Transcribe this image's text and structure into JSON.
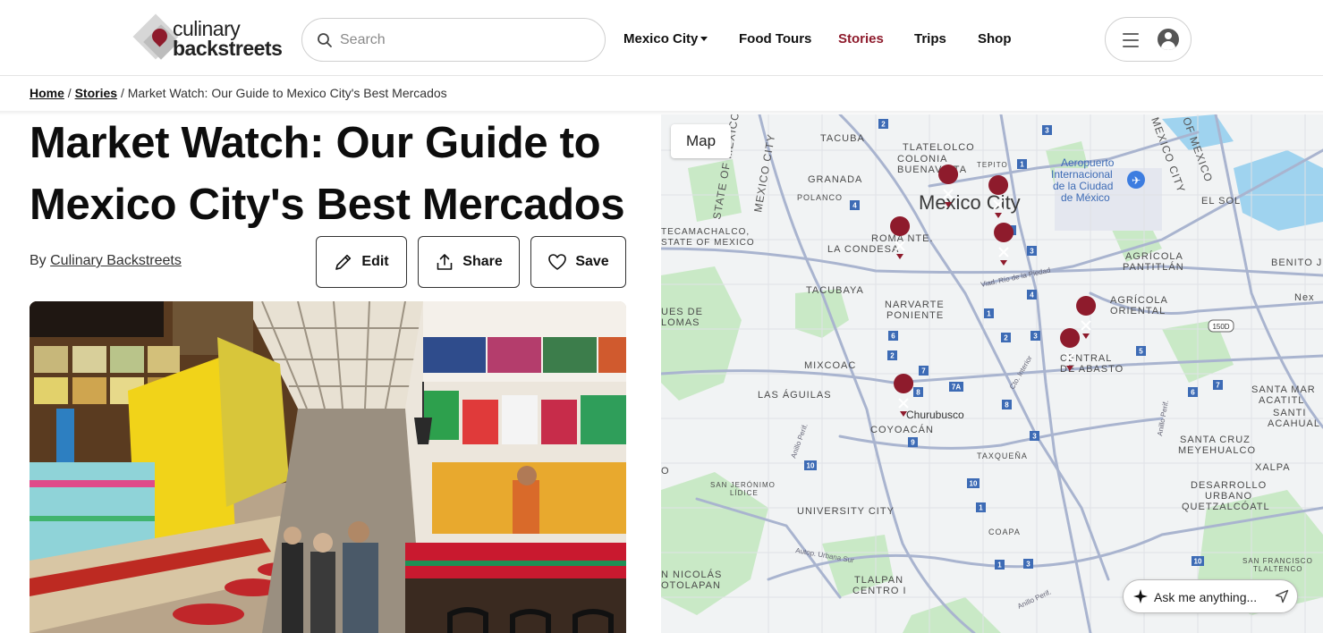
{
  "header": {
    "logo_line1": "culinary",
    "logo_line2": "backstreets",
    "search_placeholder": "Search",
    "nav": [
      {
        "label": "Mexico City",
        "has_dropdown": true
      },
      {
        "label": "Food Tours"
      },
      {
        "label": "Stories",
        "active": true
      },
      {
        "label": "Trips"
      },
      {
        "label": "Shop"
      }
    ],
    "menu_icon": "hamburger-icon",
    "user_icon": "user-avatar-icon"
  },
  "breadcrumb": {
    "home": "Home",
    "stories": "Stories",
    "separator": "/",
    "current": "Market Watch: Our Guide to Mexico City's Best Mercados"
  },
  "article": {
    "title": "Market Watch: Our Guide to Mexico City's Best Mercados",
    "by_label": "By",
    "author": "Culinary Backstreets",
    "actions": {
      "edit": "Edit",
      "share": "Share",
      "save": "Save"
    }
  },
  "map": {
    "label": "Map",
    "ask_placeholder": "Ask me anything...",
    "place_labels": [
      "TACUBA",
      "TLATELOLCO",
      "COLONIA BUENAVISTA",
      "TEPITO",
      "GRANADA",
      "POLANCO",
      "Mexico City",
      "Aeropuerto Internacional de la Ciudad de México",
      "EL SOL",
      "ROMA NTE.",
      "LA CONDESA",
      "TECAMACHALCO, STATE OF MEXICO",
      "AGRÍCOLA PANTITLÁN",
      "BENITO JUÁ",
      "TACUBAYA",
      "NARVARTE PONIENTE",
      "AGRÍCOLA ORIENTAL",
      "UES DE LOMAS",
      "MIXCOAC",
      "CENTRAL DE ABASTO",
      "LAS ÁGUILAS",
      "Churubusco",
      "COYOACÁN",
      "SANTA MARÍA ACATITLA",
      "SANTIAGO ACAHUALTEPEC",
      "SANTA CRUZ MEYEHUALCO",
      "TAXQUEÑA",
      "XALPA",
      "SAN JERÓNIMO LÍDICE",
      "DESARROLLO URBANO QUETZALCÓATL",
      "UNIVERSITY CITY",
      "COAPA",
      "SAN FRANCISCO TLALTENCO",
      "SAN NICOLÁS TOTOLAPAN",
      "TLALPAN CENTRO I",
      "STATE OF MEXICO",
      "MEXICO CITY",
      "Viad. Río de la Piedad",
      "Cto. Interior",
      "Anillo Perif.",
      "Autop. Urbana Sur"
    ],
    "pin_icon": "market-pin-icon",
    "pin_count": 8,
    "colors": {
      "pin": "#8e1b2c",
      "road": "#a9b4cf",
      "park": "#c9e9c6",
      "water": "#9fd3ef",
      "base": "#f1f3f4"
    }
  },
  "colors": {
    "accent": "#8e1b2c",
    "text": "#0d0d0d",
    "border": "#cfcfcf"
  }
}
